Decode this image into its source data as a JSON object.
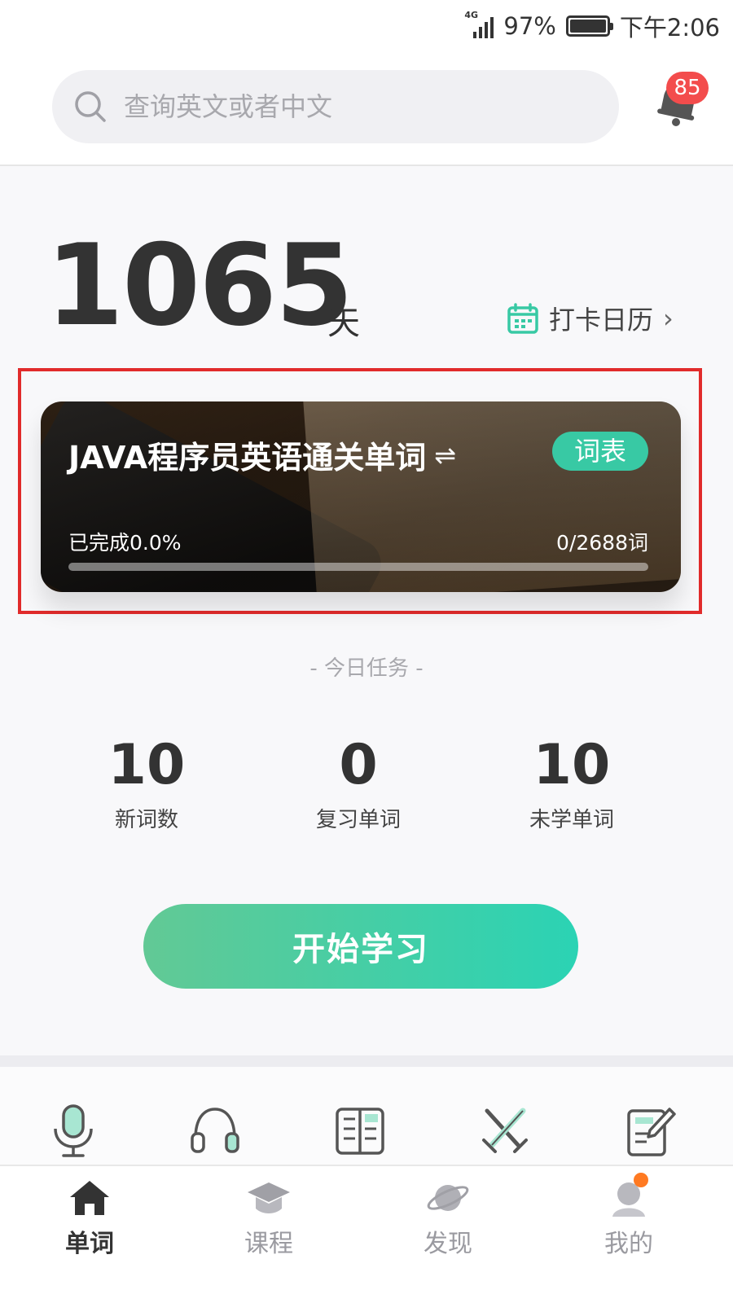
{
  "status_bar": {
    "network": "4G",
    "battery": "97%",
    "time": "下午2:06"
  },
  "search": {
    "placeholder": "查询英文或者中文"
  },
  "notifications": {
    "badge_count": "85"
  },
  "streak": {
    "days": "1065",
    "unit": "天",
    "calendar_label": "打卡日历",
    "calendar_chevron": "›"
  },
  "book": {
    "title": "JAVA程序员英语通关单词",
    "swap_symbol": "⇌",
    "wordlist_label": "词表",
    "progress_text": "已完成0.0%",
    "count_text": "0/2688词",
    "progress_fraction": 0.0
  },
  "today": {
    "title": "- 今日任务 -",
    "stats": [
      {
        "value": "10",
        "label": "新词数"
      },
      {
        "value": "0",
        "label": "复习单词"
      },
      {
        "value": "10",
        "label": "未学单词"
      }
    ]
  },
  "start_button": {
    "label": "开始学习"
  },
  "tools": [
    "microphone-icon",
    "headphones-icon",
    "book-reader-icon",
    "battle-swords-icon",
    "notepad-edit-icon"
  ],
  "tabs": [
    {
      "label": "单词",
      "icon": "home-icon",
      "active": true
    },
    {
      "label": "课程",
      "icon": "graduation-cap-icon",
      "active": false
    },
    {
      "label": "发现",
      "icon": "planet-icon",
      "active": false
    },
    {
      "label": "我的",
      "icon": "profile-icon",
      "active": false
    }
  ],
  "colors": {
    "accent": "#38c9a4",
    "button_start": "#62c995",
    "button_end": "#2bd3b4",
    "badge": "#f34c4c",
    "highlight": "#e12b2b"
  }
}
